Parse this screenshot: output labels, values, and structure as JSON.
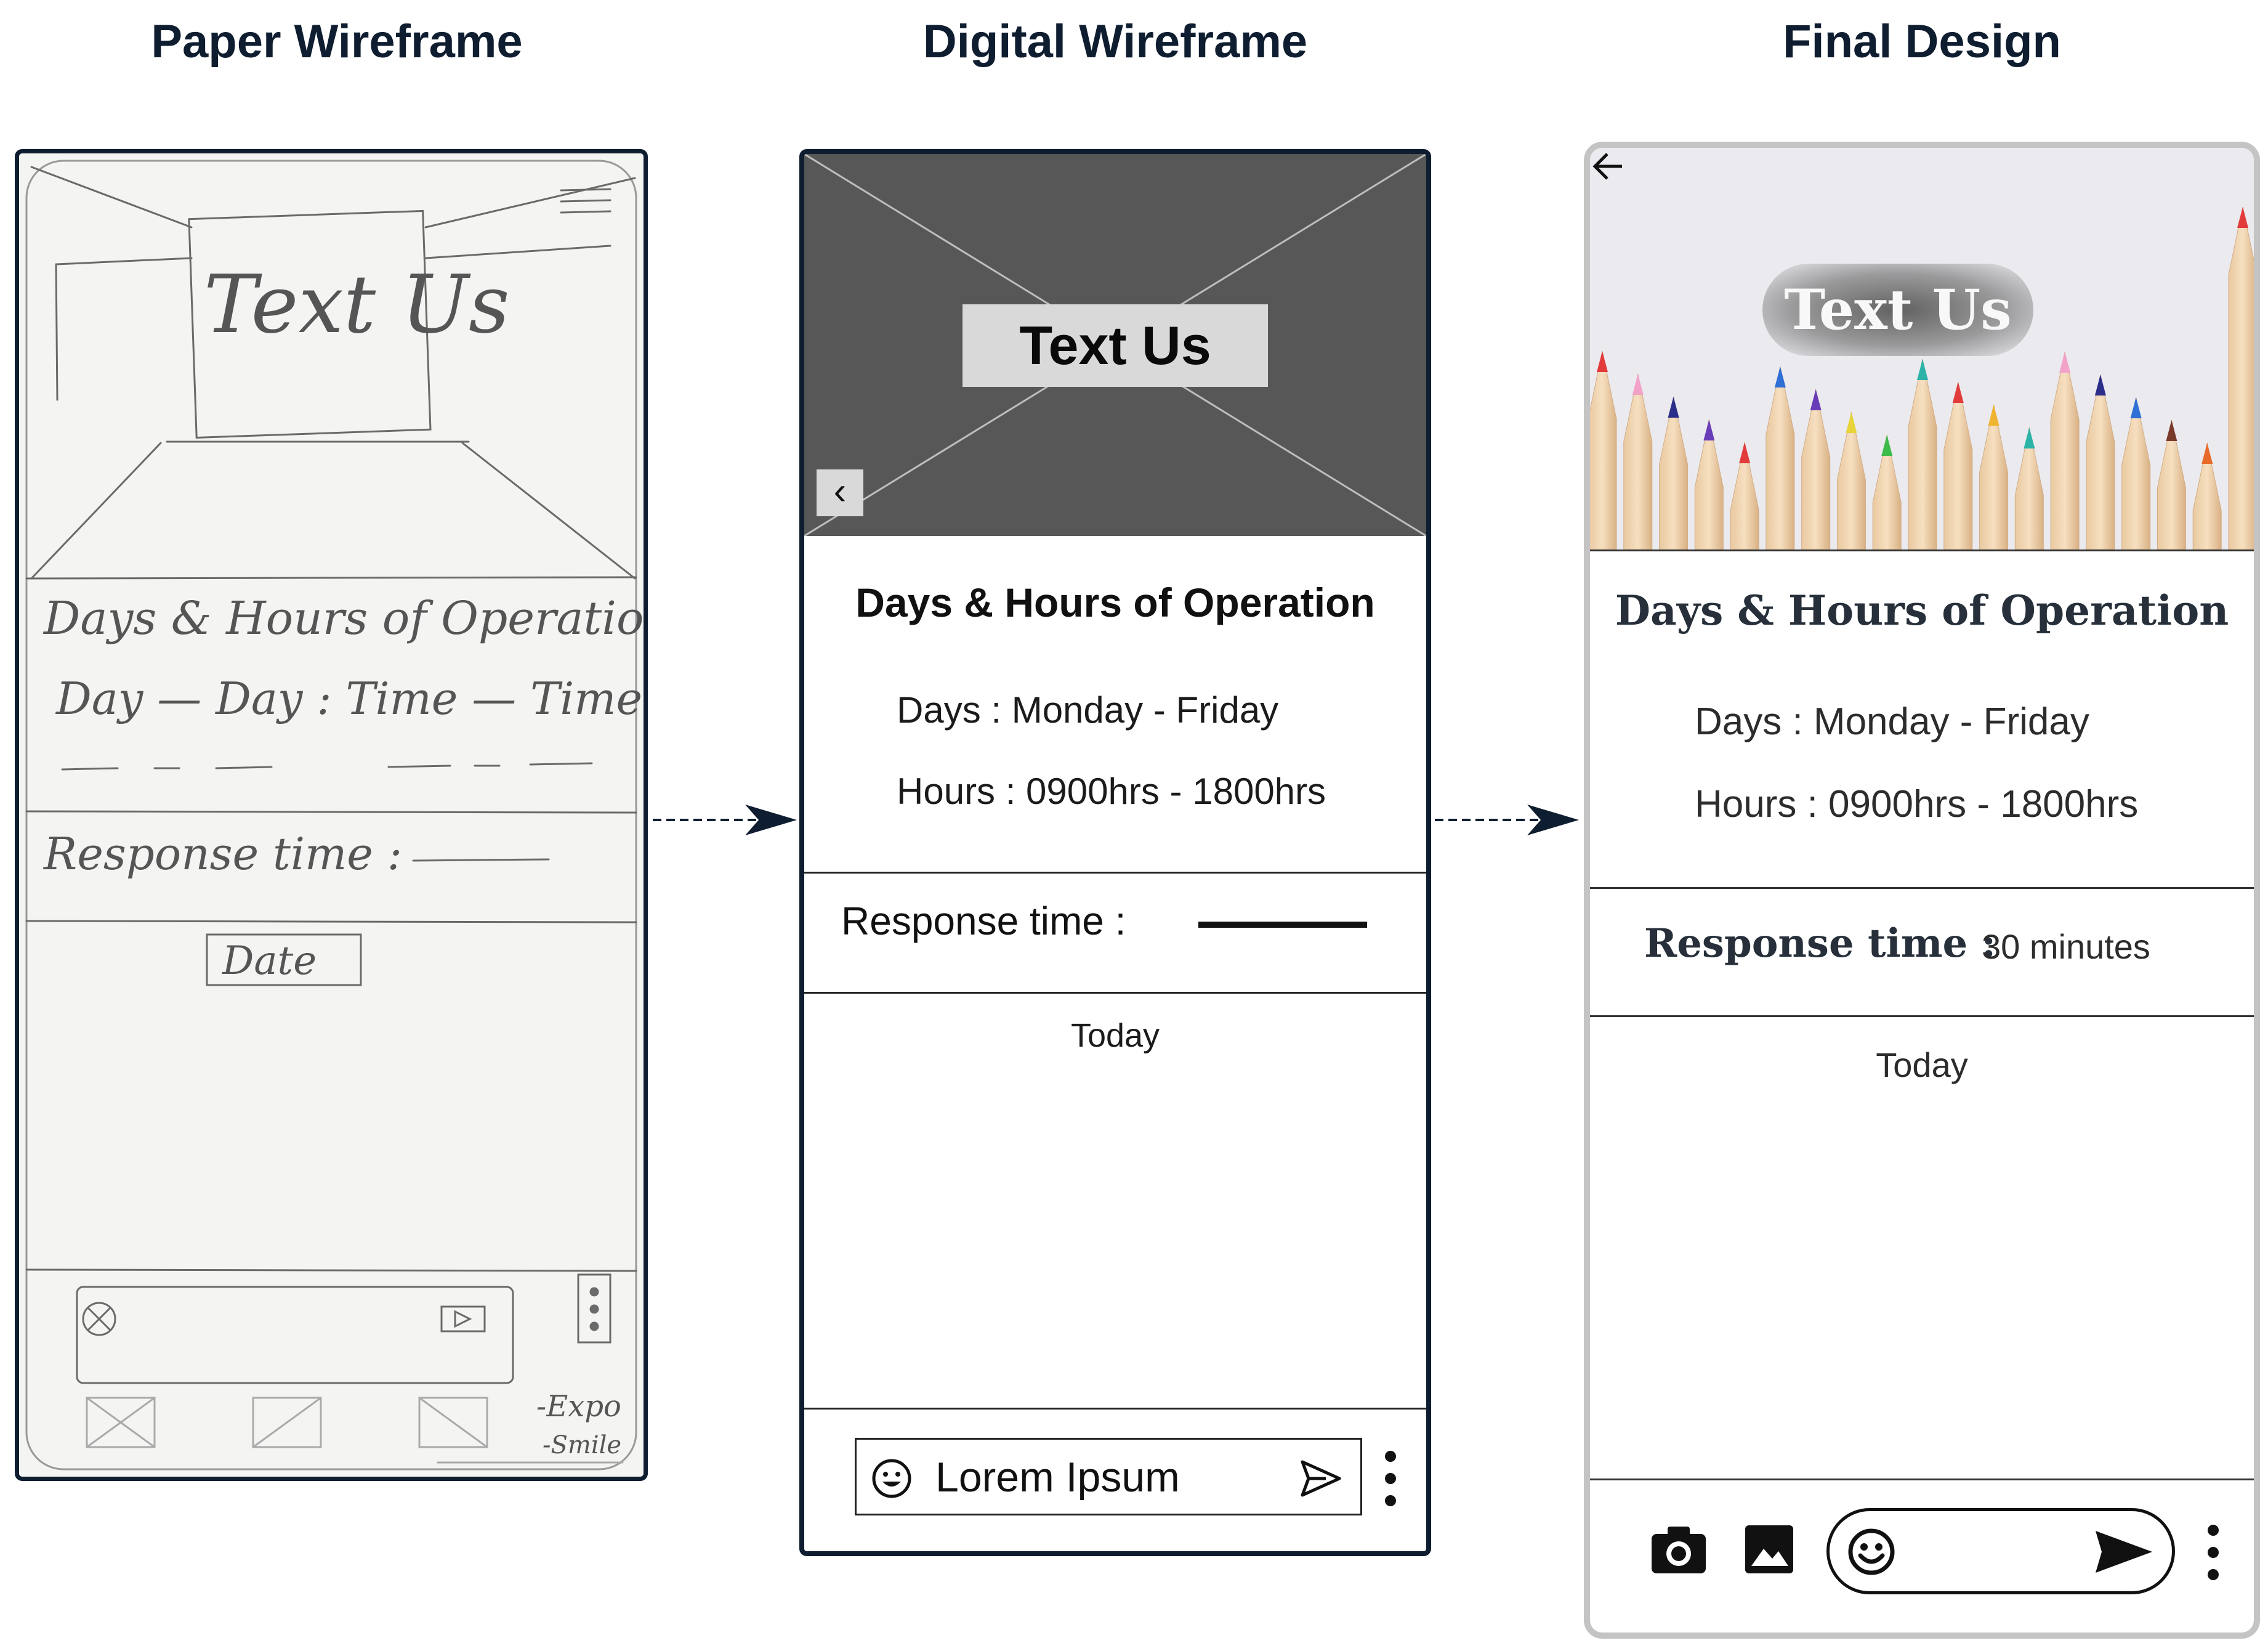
{
  "titles": {
    "paper": "Paper Wireframe",
    "digital": "Digital Wireframe",
    "final": "Final Design"
  },
  "digital": {
    "hero_title": "Text Us",
    "back_icon": "chevron-left-icon",
    "heading": "Days & Hours of Operation",
    "days": "Days : Monday - Friday",
    "hours": "Hours : 0900hrs - 1800hrs",
    "response_label": "Response time :",
    "today": "Today",
    "input_value": "Lorem Ipsum"
  },
  "final": {
    "hero_title": "Text Us",
    "back_icon": "arrow-left-icon",
    "heading": "Days & Hours of Operation",
    "days": "Days : Monday - Friday",
    "hours": "Hours : 0900hrs - 1800hrs",
    "response_label": "Response time :",
    "response_value": "30 minutes",
    "today": "Today",
    "icons": [
      "camera-icon",
      "image-icon",
      "emoji-icon",
      "send-icon",
      "more-vertical-icon"
    ]
  },
  "paper": {
    "hero_text": "Text Us",
    "heading": "Days & Hours of Operation",
    "line": "Day — Day : Time — Time",
    "response": "Response time :",
    "date": "Date",
    "expo": "-Expo",
    "smile": "-Smile"
  },
  "colors": {
    "title_text": "#0f1d30",
    "wireframe_hero": "#575757",
    "final_frame": "#c4c4c4"
  }
}
